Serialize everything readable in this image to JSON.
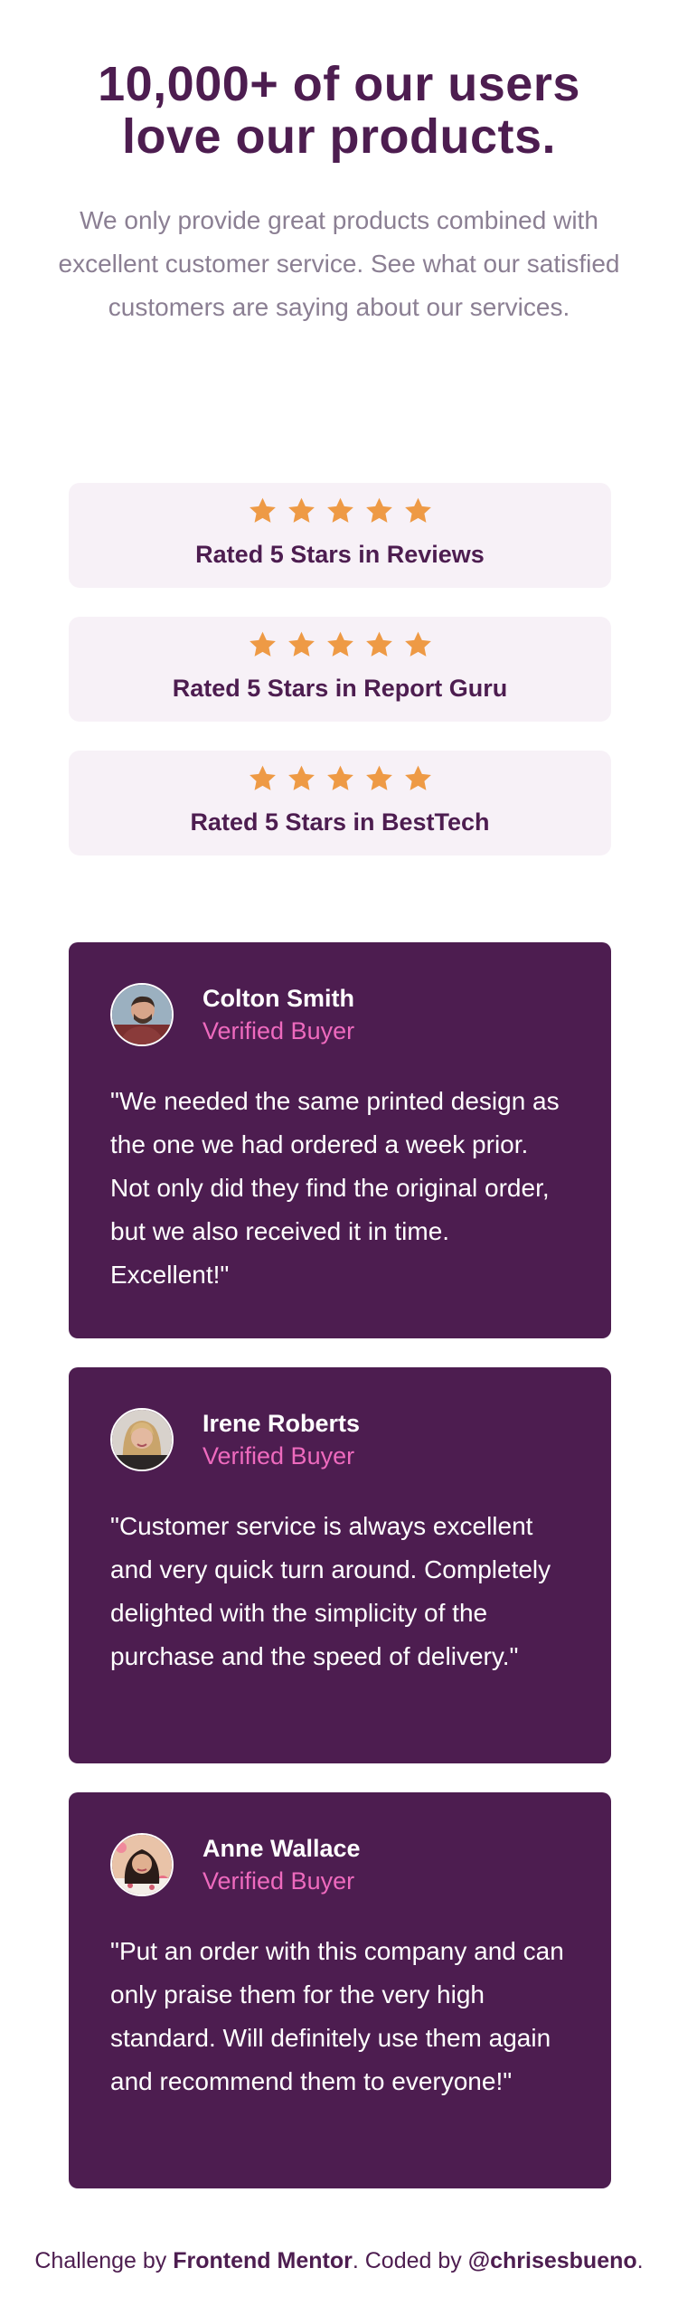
{
  "hero": {
    "title": "10,000+ of our users love our products.",
    "subtitle": "We only provide great products combined with excellent customer service. See what our satisfied customers are saying about our services."
  },
  "ratings": [
    {
      "stars": 5,
      "label": "Rated 5 Stars in Reviews"
    },
    {
      "stars": 5,
      "label": "Rated 5 Stars in Report Guru"
    },
    {
      "stars": 5,
      "label": "Rated 5 Stars in BestTech"
    }
  ],
  "reviews": [
    {
      "name": "Colton Smith",
      "status": "Verified Buyer",
      "text": "\"We needed the same printed design as the one we had ordered a week prior. Not only did they find the original order, but we also received it in time. Excellent!\""
    },
    {
      "name": "Irene Roberts",
      "status": "Verified Buyer",
      "text": "\"Customer service is always excellent and very quick turn around. Completely delighted with the simplicity of the purchase and the speed of delivery.\""
    },
    {
      "name": "Anne Wallace",
      "status": "Verified Buyer",
      "text": "\"Put an order with this company and can only praise them for the very high standard. Will definitely use them again and recommend them to everyone!\""
    }
  ],
  "footer": {
    "prefix": "Challenge by ",
    "frontend_mentor": "Frontend Mentor",
    "middle": ". Coded by ",
    "author": "@chrisesbueno",
    "suffix": "."
  },
  "colors": {
    "primary": "#4d1d50",
    "accent_pink": "#ee6abe",
    "star": "#ee9a45",
    "rating_bg": "#f7f1f7",
    "subtitle_text": "#8b7f93"
  },
  "icons": {
    "star": "star-icon",
    "avatar": "avatar-image"
  }
}
